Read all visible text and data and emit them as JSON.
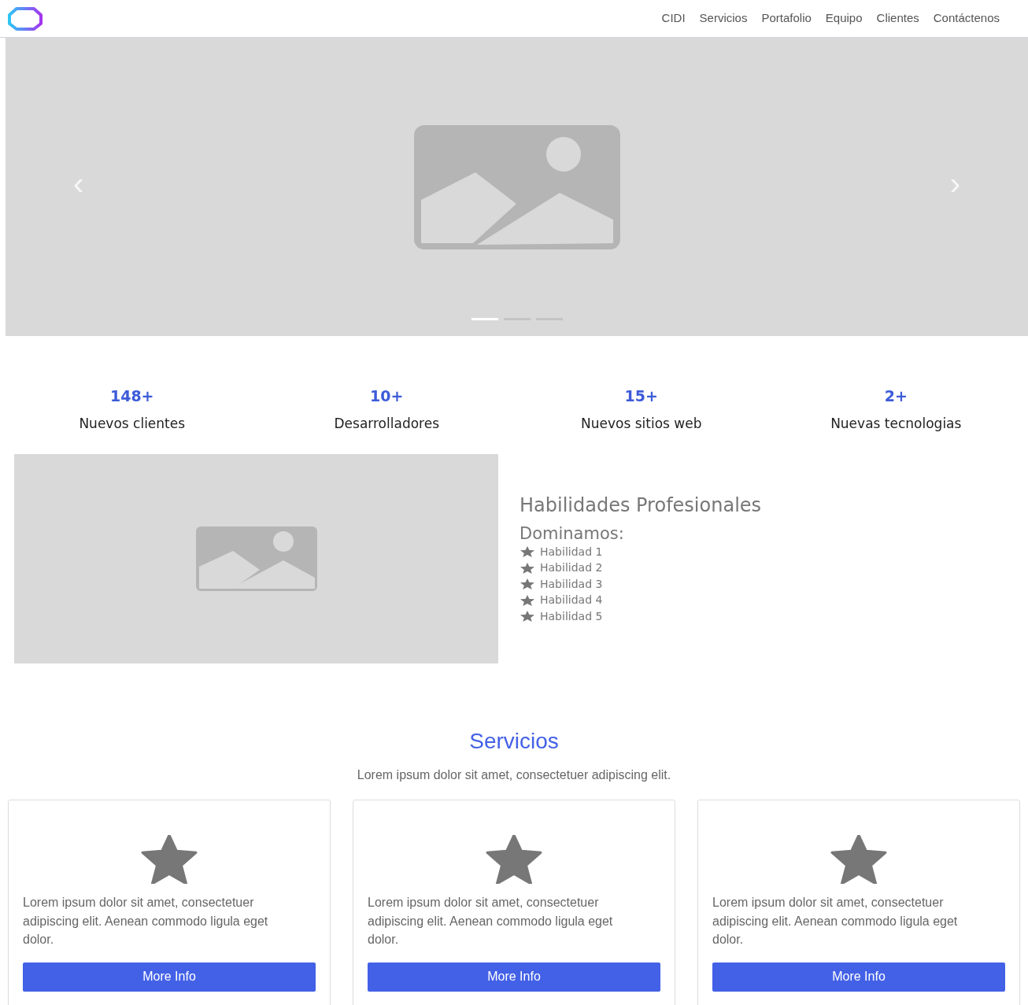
{
  "nav": {
    "links": [
      "CIDI",
      "Servicios",
      "Portafolio",
      "Equipo",
      "Clientes",
      "Contáctenos"
    ]
  },
  "carousel": {
    "prev": "‹",
    "next": "›",
    "indicators": [
      {
        "selected": true
      },
      {
        "selected": false
      },
      {
        "selected": false
      }
    ]
  },
  "stats": [
    {
      "value": "148+",
      "label": "Nuevos clientes"
    },
    {
      "value": "10+",
      "label": "Desarrolladores"
    },
    {
      "value": "15+",
      "label": "Nuevos sitios web"
    },
    {
      "value": "2+",
      "label": "Nuevas tecnologias"
    }
  ],
  "skills": {
    "title": "Habilidades Profesionales",
    "subtitle": "Dominamos:",
    "items": [
      "Habilidad 1",
      "Habilidad 2",
      "Habilidad 3",
      "Habilidad 4",
      "Habilidad 5"
    ]
  },
  "services": {
    "title": "Servicios",
    "subtitle": "Lorem ipsum dolor sit amet, consectetuer adipiscing elit.",
    "cards": [
      {
        "text": "Lorem ipsum dolor sit amet, consectetuer adipiscing elit. Aenean commodo ligula eget dolor.",
        "button": "More Info"
      },
      {
        "text": "Lorem ipsum dolor sit amet, consectetuer adipiscing elit. Aenean commodo ligula eget dolor.",
        "button": "More Info"
      },
      {
        "text": "Lorem ipsum dolor sit amet, consectetuer adipiscing elit. Aenean commodo ligula eget dolor.",
        "button": "More Info"
      }
    ]
  }
}
